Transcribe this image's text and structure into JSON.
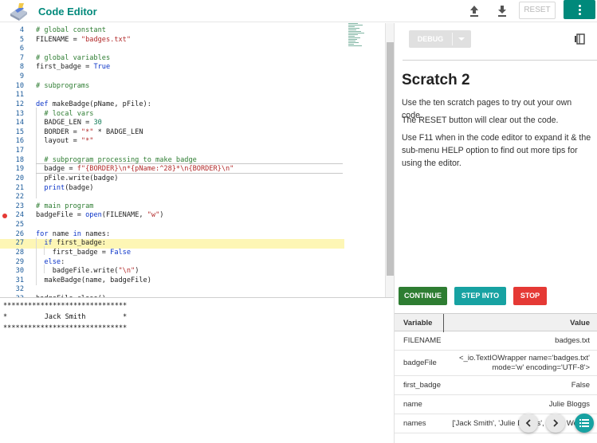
{
  "header": {
    "title": "Code Editor",
    "reset_label": "RESET",
    "icons": [
      "upload-icon",
      "download-icon",
      "more-vert-icon"
    ],
    "accent_color": "#00897b"
  },
  "editor": {
    "lines": [
      {
        "n": "4",
        "code": "# global constant"
      },
      {
        "n": "5",
        "code": "FILENAME = \"badges.txt\""
      },
      {
        "n": "6",
        "code": ""
      },
      {
        "n": "7",
        "code": "# global variables"
      },
      {
        "n": "8",
        "code": "first_badge = True"
      },
      {
        "n": "9",
        "code": ""
      },
      {
        "n": "10",
        "code": "# subprograms"
      },
      {
        "n": "11",
        "code": ""
      },
      {
        "n": "12",
        "code": "def makeBadge(pName, pFile):"
      },
      {
        "n": "13",
        "code": "  # local vars"
      },
      {
        "n": "14",
        "code": "  BADGE_LEN = 30"
      },
      {
        "n": "15",
        "code": "  BORDER = \"*\" * BADGE_LEN"
      },
      {
        "n": "16",
        "code": "  layout = \"*\""
      },
      {
        "n": "17",
        "code": ""
      },
      {
        "n": "18",
        "code": "  # subprogram processing to make badge"
      },
      {
        "n": "19",
        "code": "  badge = f\"{BORDER}\\n*{pName:^28}*\\n{BORDER}\\n\""
      },
      {
        "n": "20",
        "code": "  pFile.write(badge)"
      },
      {
        "n": "21",
        "code": "  print(badge)"
      },
      {
        "n": "22",
        "code": ""
      },
      {
        "n": "23",
        "code": "# main program"
      },
      {
        "n": "24",
        "code": "badgeFile = open(FILENAME, \"w\")"
      },
      {
        "n": "25",
        "code": ""
      },
      {
        "n": "26",
        "code": "for name in names:"
      },
      {
        "n": "27",
        "code": "  if first_badge:"
      },
      {
        "n": "28",
        "code": "    first_badge = False"
      },
      {
        "n": "29",
        "code": "  else:"
      },
      {
        "n": "30",
        "code": "    badgeFile.write(\"\\n\")"
      },
      {
        "n": "31",
        "code": "  makeBadge(name, badgeFile)"
      },
      {
        "n": "32",
        "code": ""
      },
      {
        "n": "33",
        "code": "badgeFile.close()"
      }
    ],
    "highlighted_line": "27",
    "breakpoint_line": "24"
  },
  "console": {
    "lines": [
      "******************************",
      "*         Jack Smith         *",
      "******************************"
    ]
  },
  "debug": {
    "debug_label": "DEBUG",
    "scratch_title": "Scratch 2",
    "paragraphs": [
      "Use the ten scratch pages to try out your own code.",
      "The RESET button will clear out the code.",
      "Use F11 when in the code editor to expand it & the sub-menu HELP option to find out more tips for using the editor."
    ],
    "continue_label": "CONTINUE",
    "step_into_label": "STEP INTO",
    "stop_label": "STOP",
    "continue_color": "#2e7d32",
    "step_into_color": "#17a2a2",
    "stop_color": "#e53935"
  },
  "variables": {
    "col_variable": "Variable",
    "col_value": "Value",
    "rows": [
      {
        "name": "FILENAME",
        "value": "badges.txt"
      },
      {
        "name": "badgeFile",
        "value": "<_io.TextIOWrapper name='badges.txt' mode='w' encoding='UTF-8'>"
      },
      {
        "name": "first_badge",
        "value": "False"
      },
      {
        "name": "name",
        "value": "Julie Bloggs"
      },
      {
        "name": "names",
        "value": "['Jack Smith', 'Julie Bloggs', 'Mary Wood']"
      }
    ]
  }
}
